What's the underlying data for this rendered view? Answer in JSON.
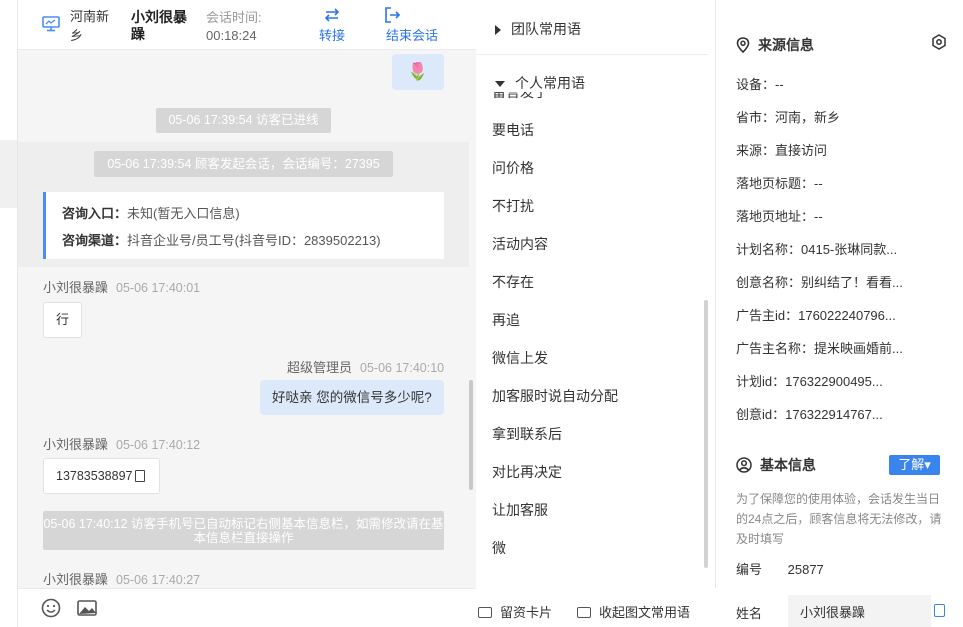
{
  "header": {
    "location": "河南新乡",
    "visitor_name": "小刘很暴躁",
    "session_time_label": "会话时间:",
    "session_time": "00:18:24",
    "transfer_label": "转接",
    "end_label": "结束会话"
  },
  "messages": {
    "flower": "🌷",
    "visitor_entered": "05-06 17:39:54 访客已进线",
    "session_started": "05-06 17:39:54 顾客发起会话，会话编号：27395",
    "entry_label": "咨询入口：",
    "entry_value": "未知(暂无入口信息)",
    "channel_label": "咨询渠道：",
    "channel_value": "抖音企业号/员工号(抖音号ID：2839502213)",
    "msg1_sender": "小刘很暴躁",
    "msg1_time": "05-06 17:40:01",
    "msg1_text": "行",
    "msg2_sender": "超级管理员",
    "msg2_time": "05-06 17:40:10",
    "msg2_text": "好哒亲 您的微信号多少呢?",
    "msg3_sender": "小刘很暴躁",
    "msg3_time": "05-06 17:40:12",
    "msg3_text": "13783538897",
    "auto_mark_notice": "05-06 17:40:12 访客手机号已自动标记右侧基本信息栏，如需修改请在基本信息栏直接操作",
    "msg4_sender": "小刘很暴躁",
    "msg4_time": "05-06 17:40:27"
  },
  "phrases": {
    "team_title": "团队常用语",
    "personal_title": "个人常用语",
    "partial_item": "留言发了",
    "items": [
      "要电话",
      "问价格",
      "不打扰",
      "活动内容",
      "不存在",
      "再追",
      "微信上发",
      "加客服时说自动分配",
      "拿到联系后",
      "对比再决定",
      "让加客服",
      "微"
    ],
    "card_button": "留资卡片",
    "collapse_button": "收起图文常用语"
  },
  "source_info": {
    "title": "来源信息",
    "device": "设备：--",
    "province": "省市：河南，新乡",
    "source": "来源：直接访问",
    "landing_title": "落地页标题：--",
    "landing_url": "落地页地址：--",
    "plan_name": "计划名称：0415-张琳同款...",
    "creative_name": "创意名称：别纠结了！看看...",
    "advertiser_id": "广告主id：176022240796...",
    "advertiser_name": "广告主名称：提米映画婚前...",
    "plan_id": "计划id：176322900495...",
    "creative_id": "创意id：176322914767..."
  },
  "basic_info": {
    "title": "基本信息",
    "learn_label": "了解▾",
    "note": "为了保障您的使用体验，会话发生当日的24点之后，顾客信息将无法修改，请及时填写",
    "id_label": "编号",
    "id_value": "25877",
    "name_label": "姓名",
    "name_value": "小刘很暴躁"
  }
}
